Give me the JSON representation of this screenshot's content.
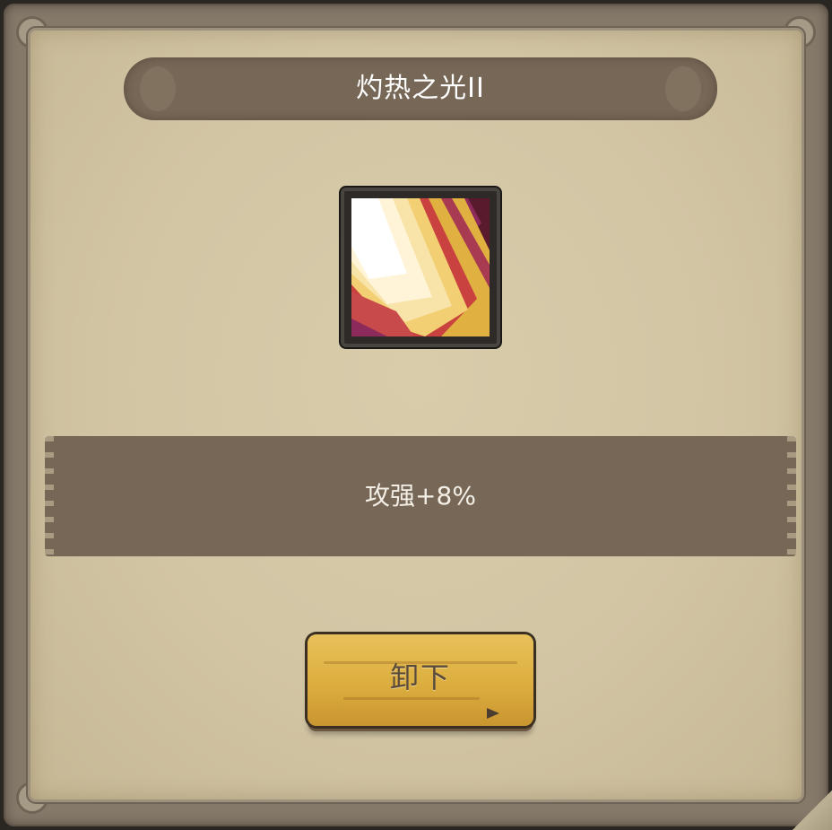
{
  "dialog": {
    "title": "灼热之光II",
    "skill_icon": "blazing-light-rays-icon",
    "description": "攻强+8%",
    "unequip_label": "卸下"
  },
  "colors": {
    "parchment": "#d2c5a4",
    "banner": "#766756",
    "button": "#dcae3f",
    "icon_magenta": "#8c2a5c",
    "icon_gold": "#e0b040",
    "icon_cream": "#fff4d8"
  }
}
